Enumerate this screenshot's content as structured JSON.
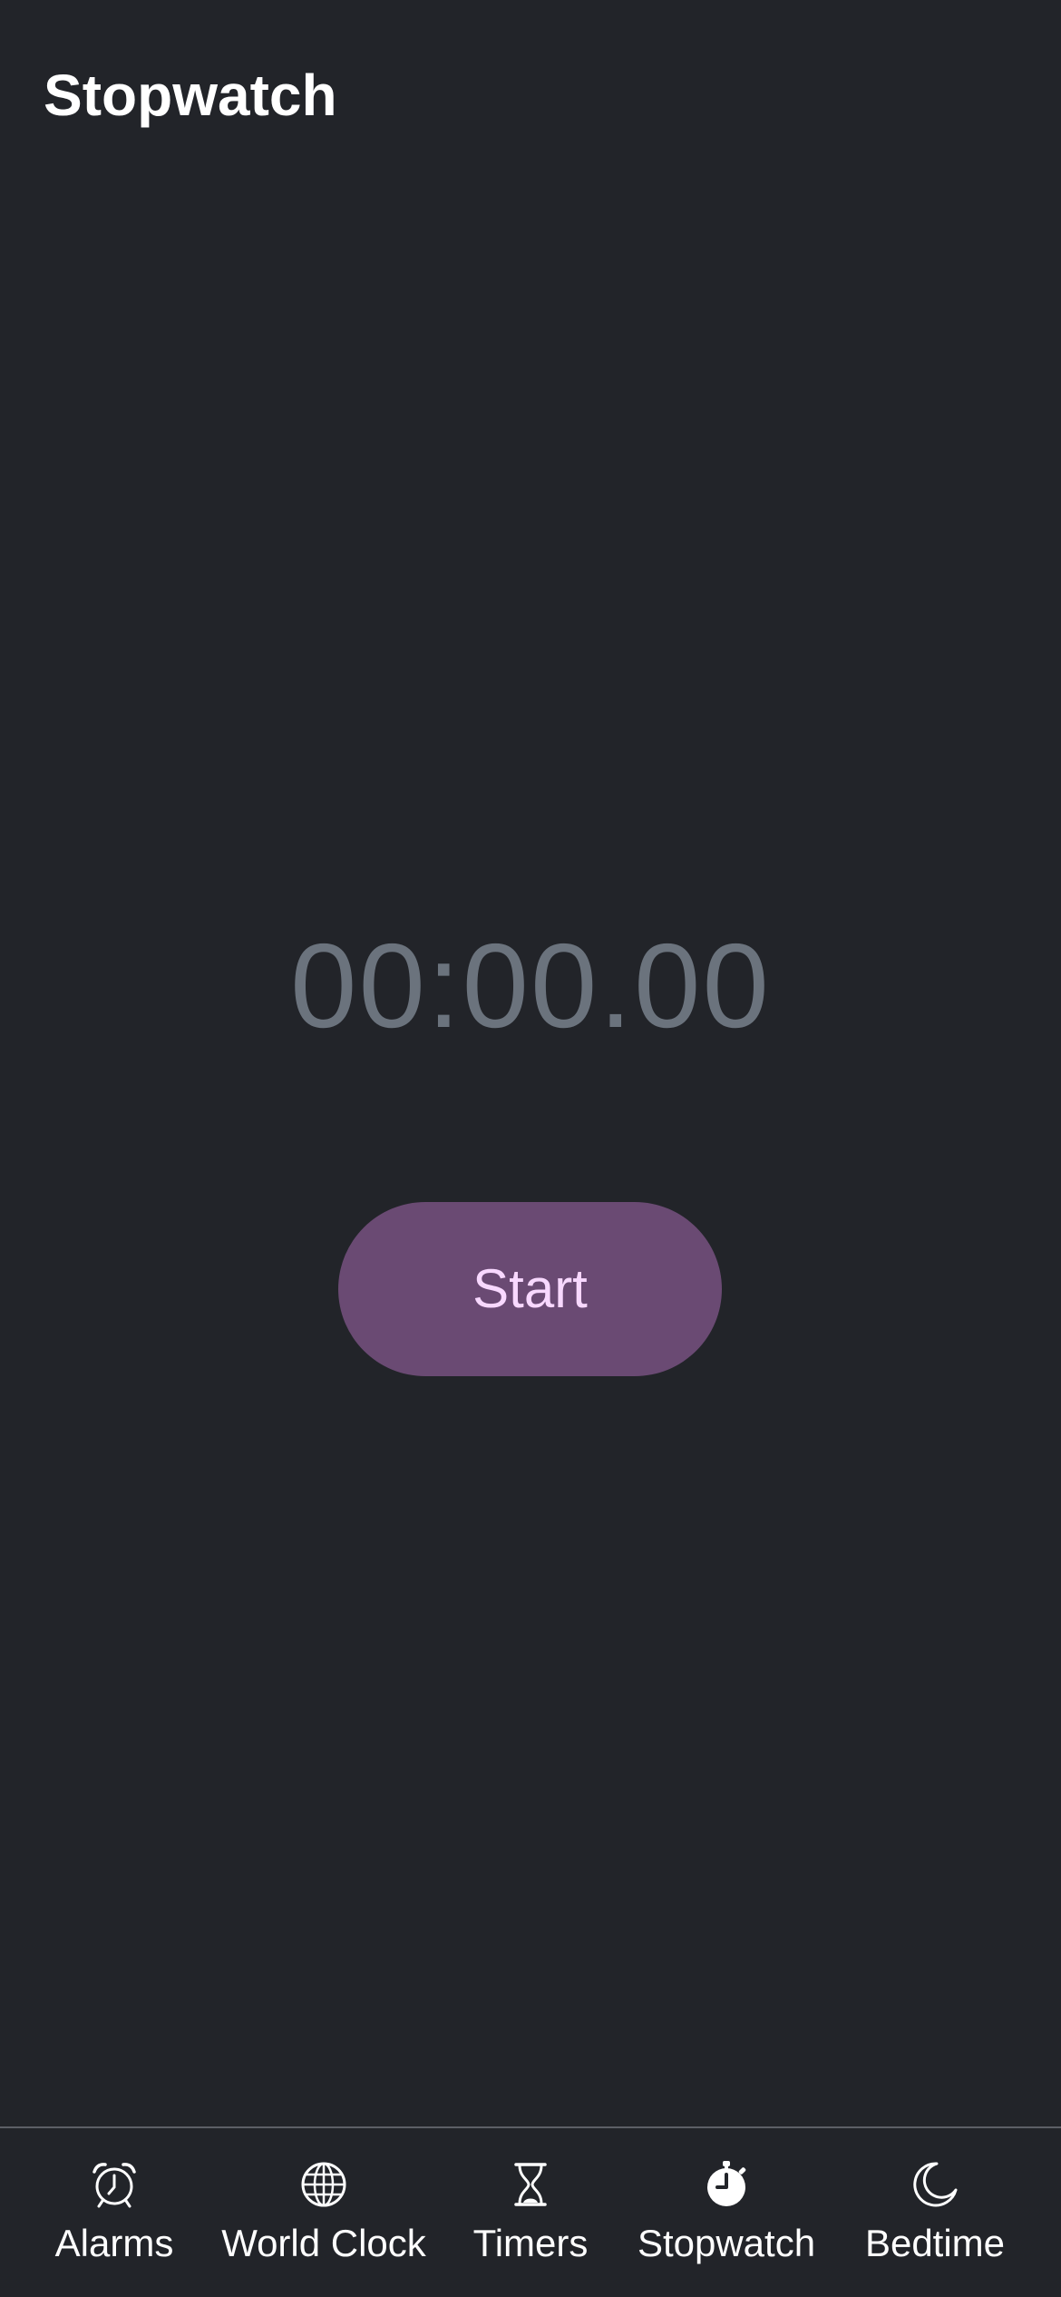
{
  "header": {
    "title": "Stopwatch"
  },
  "stopwatch": {
    "time": "00:00.00",
    "start_label": "Start"
  },
  "colors": {
    "background": "#222429",
    "time_text": "#6b737d",
    "start_button_bg": "#6a4a73",
    "start_button_text": "#f8d8ff",
    "tab_divider": "#5c5f66"
  },
  "tab_bar": {
    "active": "Stopwatch",
    "tabs": [
      {
        "label": "Alarms",
        "icon": "alarm-clock-icon"
      },
      {
        "label": "World Clock",
        "icon": "globe-icon"
      },
      {
        "label": "Timers",
        "icon": "hourglass-icon"
      },
      {
        "label": "Stopwatch",
        "icon": "stopwatch-icon"
      },
      {
        "label": "Bedtime",
        "icon": "moon-icon"
      }
    ]
  }
}
